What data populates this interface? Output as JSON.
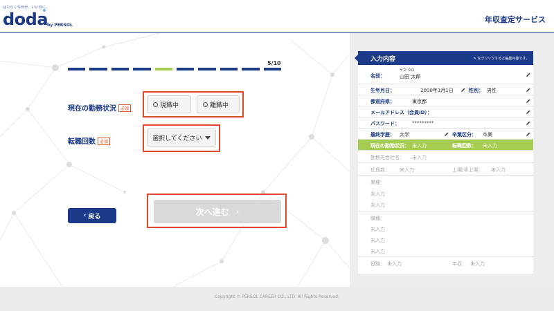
{
  "header": {
    "tagline": "はたらく今日が、いい日に。",
    "logo": "doda",
    "logo_sub": "by PERSOL",
    "service_title": "年収査定サービス"
  },
  "progress": {
    "label": "5/10",
    "total": 10,
    "current": 5
  },
  "form": {
    "status": {
      "label": "現在の勤務状況",
      "required": "必須",
      "options": [
        "現職中",
        "離職中"
      ]
    },
    "job_changes": {
      "label": "転職回数",
      "required": "必須",
      "selected": "選択してください"
    },
    "back_label": "戻る",
    "next_label": "次へ進む"
  },
  "summary": {
    "title": "入力内容",
    "hint": "をクリックすると編集可能です。",
    "name_label": "名前：",
    "name_kana": "ヤマ タロ",
    "name": "山田 太郎",
    "birth_label": "生年月日：",
    "birth": "2000年1月1日",
    "gender_label": "性別：",
    "gender": "男性",
    "pref_label": "都道府県：",
    "pref": "東京都",
    "email_label": "メールアドレス（会員ID）：",
    "password_label": "パスワード：",
    "password": "*********",
    "edu_label": "最終学歴：",
    "edu": "大学",
    "grad_label": "卒業区分：",
    "grad": "卒業",
    "status_label": "現在の勤務状況：",
    "status_value": "未入力",
    "changes_label": "転職回数：",
    "changes_value": "未入力",
    "company_label": "勤務先会社名：",
    "company_value": "未入力",
    "employees_label": "社員数：",
    "employees_value": "未入力",
    "listed_label": "上場/非上場：",
    "listed_value": "未入力",
    "industry_label": "業種：",
    "industry_v1": "未入力",
    "industry_v2": "未入力",
    "job_label": "職種：",
    "job_v1": "未入力",
    "job_v2": "未入力",
    "job_v3": "未入力",
    "position_label": "役職：",
    "position_value": "未入力",
    "income_label": "年収：",
    "income_value": "未入力"
  },
  "footer": {
    "copyright": "Copyright © PERSOL CAREER CO., LTD. All Rights Reserved."
  }
}
